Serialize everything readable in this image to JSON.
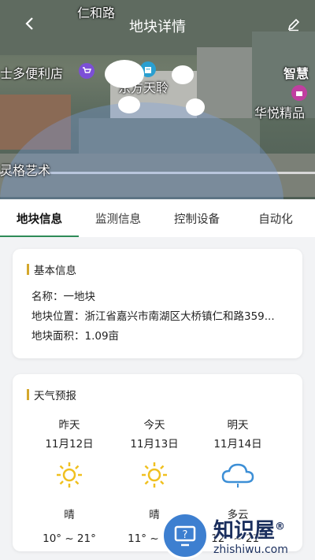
{
  "header": {
    "title": "地块详情",
    "back_icon": "back-arrow-icon",
    "edit_icon": "pencil-icon"
  },
  "map": {
    "labels": {
      "road_top": "仁和路",
      "shop_left": "士多便利店",
      "place_center": "东方天聆",
      "place_right": "智慧",
      "shop_right": "华悦精品",
      "art_left": "灵格艺术"
    }
  },
  "tabs": [
    {
      "label": "地块信息",
      "active": true
    },
    {
      "label": "监测信息",
      "active": false
    },
    {
      "label": "控制设备",
      "active": false
    },
    {
      "label": "自动化",
      "active": false
    }
  ],
  "basic_info": {
    "title": "基本信息",
    "name": "名称：一地块",
    "location": "地块位置：浙江省嘉兴市南湖区大桥镇仁和路359...",
    "area": "地块面积：1.09亩"
  },
  "weather": {
    "title": "天气预报",
    "days": [
      {
        "day": "昨天",
        "date": "11月12日",
        "icon": "sun-icon",
        "desc": "晴",
        "temp": "10° ~ 21°"
      },
      {
        "day": "今天",
        "date": "11月13日",
        "icon": "sun-icon",
        "desc": "晴",
        "temp": "11° ~ 21°"
      },
      {
        "day": "明天",
        "date": "11月14日",
        "icon": "cloud-icon",
        "desc": "多云",
        "temp": "12° ~ 21°"
      }
    ]
  },
  "watermark": {
    "title": "知识屋",
    "reg": "®",
    "url": "zhishiwu.com"
  },
  "colors": {
    "accent": "#2e8b57",
    "title_bar": "#d4a72c",
    "sun": "#f0c020",
    "cloud": "#3d8fd6"
  }
}
